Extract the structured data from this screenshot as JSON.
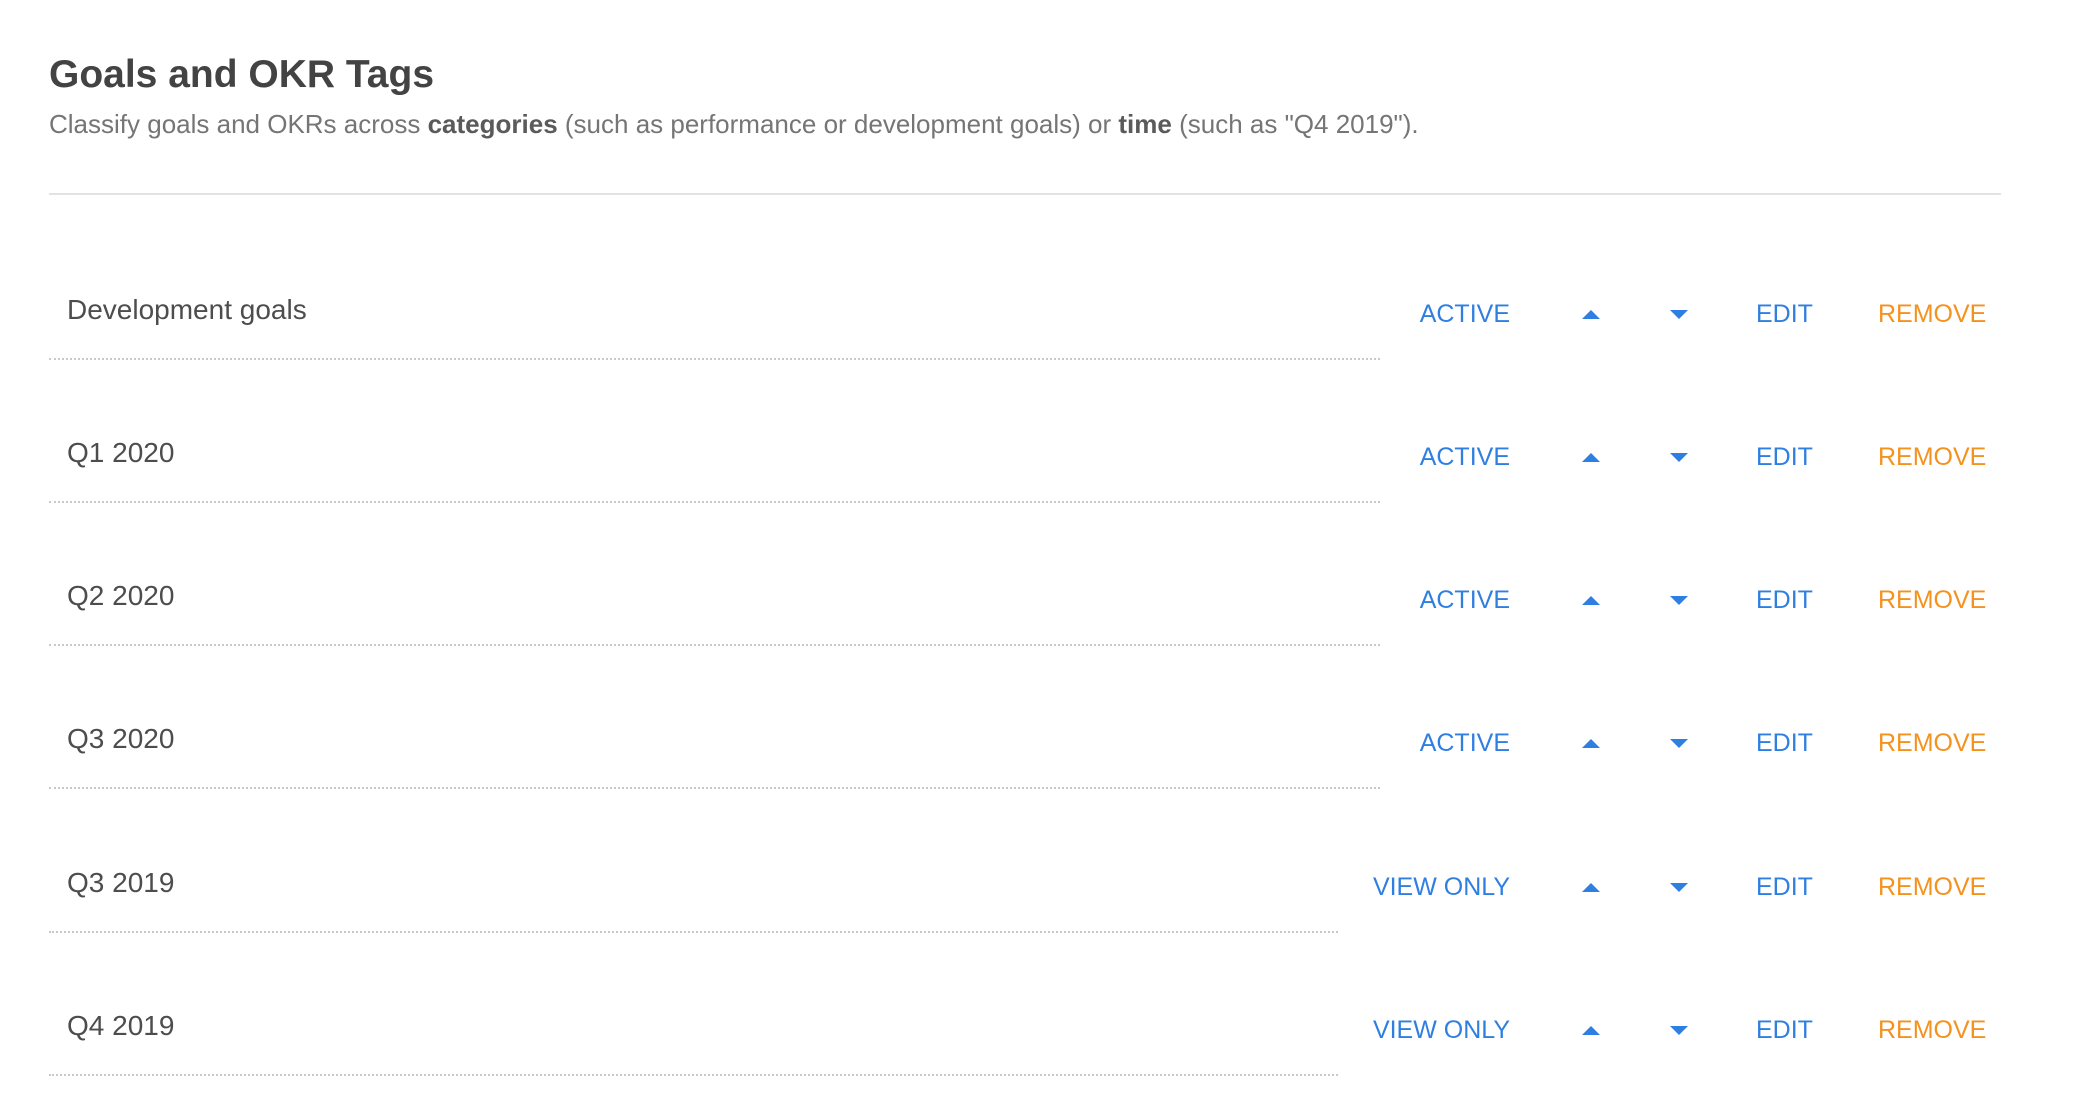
{
  "header": {
    "title": "Goals and OKR Tags",
    "desc_before": "Classify goals and OKRs across ",
    "desc_bold_1": "categories",
    "desc_middle": " (such as performance or development goals) or ",
    "desc_bold_2": "time",
    "desc_after": " (such as \"Q4 2019\")."
  },
  "colors": {
    "link_blue": "#2f7fe2",
    "remove_orange": "#f5921e"
  },
  "icons": {
    "move_up": "caret-up-icon",
    "move_down": "caret-down-icon"
  },
  "tags": [
    {
      "name": "Development goals",
      "status": "ACTIVE",
      "edit": "EDIT",
      "remove": "REMOVE"
    },
    {
      "name": "Q1 2020",
      "status": "ACTIVE",
      "edit": "EDIT",
      "remove": "REMOVE"
    },
    {
      "name": "Q2 2020",
      "status": "ACTIVE",
      "edit": "EDIT",
      "remove": "REMOVE"
    },
    {
      "name": "Q3 2020",
      "status": "ACTIVE",
      "edit": "EDIT",
      "remove": "REMOVE"
    },
    {
      "name": "Q3 2019",
      "status": "VIEW ONLY",
      "edit": "EDIT",
      "remove": "REMOVE"
    },
    {
      "name": "Q4 2019",
      "status": "VIEW ONLY",
      "edit": "EDIT",
      "remove": "REMOVE"
    }
  ]
}
